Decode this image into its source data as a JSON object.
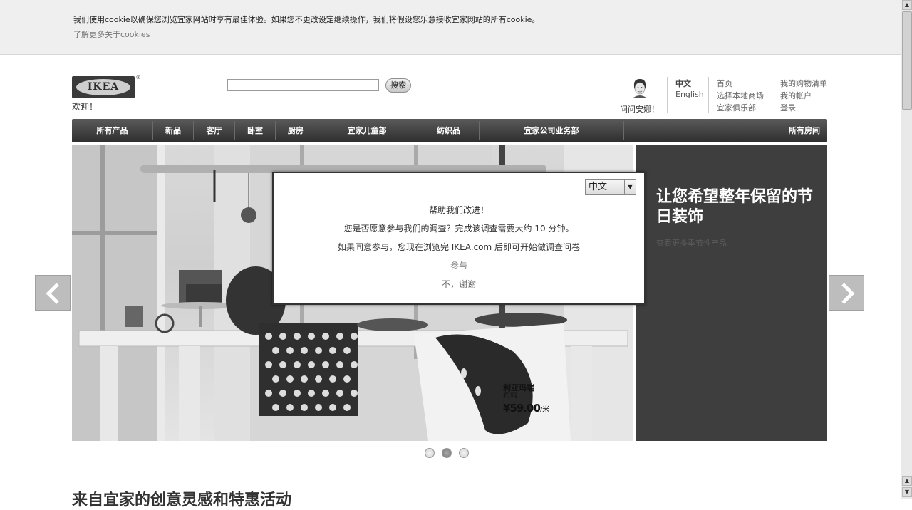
{
  "cookie": {
    "text": "我们使用cookie以确保您浏览宜家网站时享有最佳体验。如果您不更改设定继续操作，我们将假设您乐意接收宜家网站的所有cookie。",
    "link": "了解更多关于cookies"
  },
  "header": {
    "logo": "IKEA",
    "welcome": "欢迎！",
    "search_button": "搜索",
    "ask_anna": "问问安娜！",
    "lang_cn": "中文",
    "lang_en": "English",
    "links_col1": [
      "首页",
      "选择本地商场",
      "宜家俱乐部"
    ],
    "links_col2": [
      "我的购物清单",
      "我的帐户",
      "登录"
    ]
  },
  "nav": {
    "items": [
      "所有产品",
      "新品",
      "客厅",
      "卧室",
      "厨房",
      "宜家儿童部",
      "纺织品",
      "宜家公司业务部",
      "所有房间"
    ]
  },
  "hero": {
    "title": "让您希望整年保留的节日装饰",
    "link": "查看更多季节性产品",
    "product_name": "利亚玛瑞",
    "product_type": "布料",
    "product_price": "¥59.00",
    "product_unit": "/米",
    "active_slide": 2,
    "slide_count": 3
  },
  "survey": {
    "language": "中文",
    "heading": "帮助我们改进！",
    "line1": "您是否愿意参与我们的调查？完成该调查需要大约 10 分钟。",
    "line2": "如果同意参与，您现在浏览完 IKEA.com 后即可开始做调查问卷",
    "accept": "参与",
    "decline": "不，谢谢"
  },
  "section_title": "来自宜家的创意灵感和特惠活动"
}
